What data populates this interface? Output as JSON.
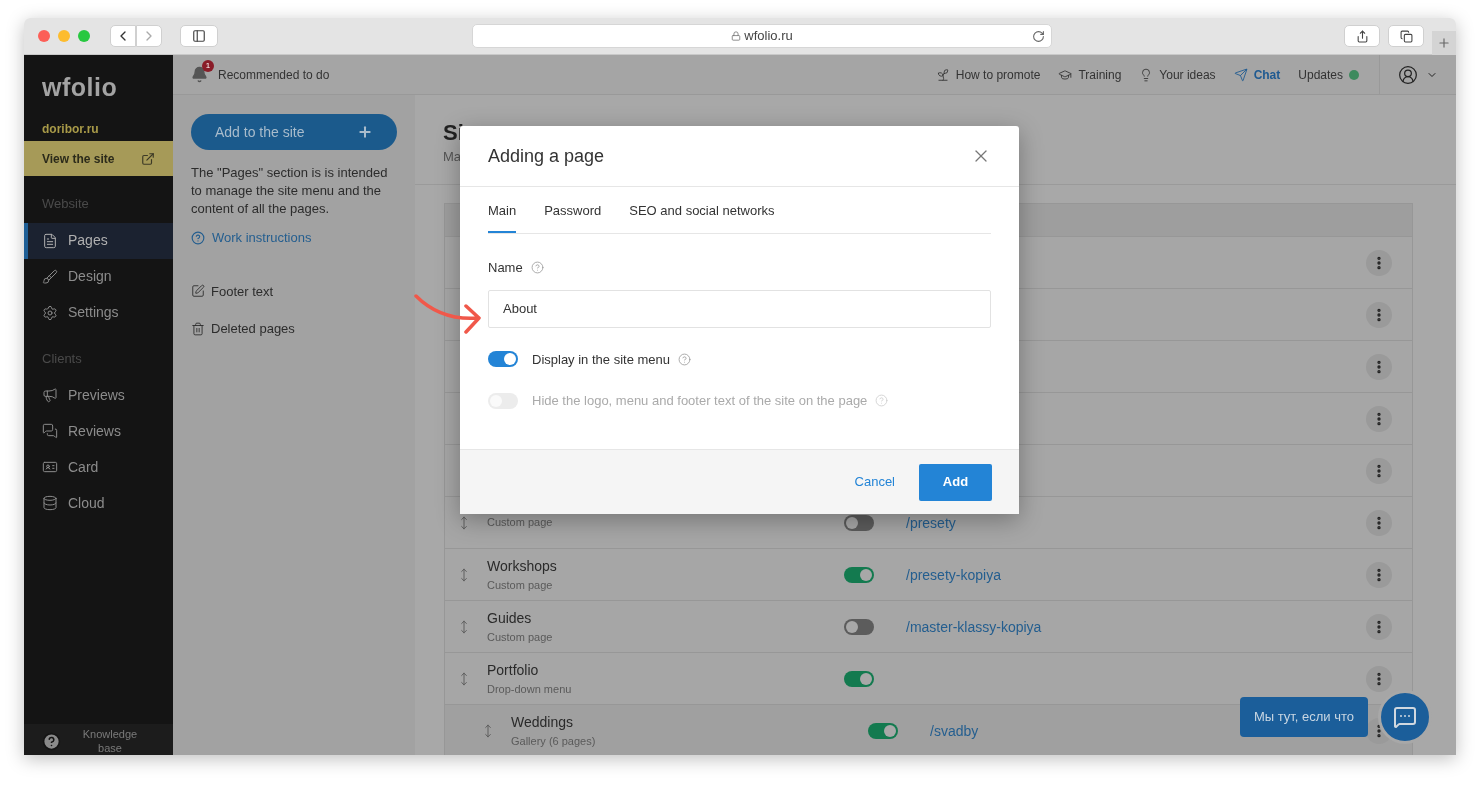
{
  "browser": {
    "address": "wfolio.ru"
  },
  "sidebar": {
    "logo": "wfolio",
    "site": "doribor.ru",
    "view_site": "View the site",
    "sections": [
      {
        "title": "Website",
        "items": [
          {
            "label": "Pages",
            "selected": true
          },
          {
            "label": "Design",
            "selected": false
          },
          {
            "label": "Settings",
            "selected": false
          }
        ]
      },
      {
        "title": "Clients",
        "items": [
          {
            "label": "Previews",
            "selected": false
          },
          {
            "label": "Reviews",
            "selected": false
          },
          {
            "label": "Card",
            "selected": false
          },
          {
            "label": "Cloud",
            "selected": false
          }
        ]
      }
    ],
    "help": "Knowledge base"
  },
  "topbar": {
    "notification": {
      "count": "1",
      "label": "Recommended to do"
    },
    "links": [
      {
        "label": "How to promote",
        "active": false,
        "dot": false
      },
      {
        "label": "Training",
        "active": false,
        "dot": false
      },
      {
        "label": "Your ideas",
        "active": false,
        "dot": false
      },
      {
        "label": "Chat",
        "active": true,
        "dot": false
      },
      {
        "label": "Updates",
        "active": false,
        "dot": true
      }
    ]
  },
  "left_panel": {
    "add_button": "Add to the site",
    "description": "The \"Pages\" section is is intended to manage the site menu and the content of all the pages.",
    "help_link": "Work instructions",
    "links": [
      {
        "label": "Footer text"
      },
      {
        "label": "Deleted pages"
      }
    ]
  },
  "page": {
    "title": "Si",
    "subtitle": "Ma"
  },
  "table": {
    "rows": [
      {},
      {},
      {},
      {},
      {},
      {
        "subtitle": "Custom page",
        "on": false,
        "link": "/presety"
      },
      {
        "title": "Workshops",
        "subtitle": "Custom page",
        "on": true,
        "link": "/presety-kopiya"
      },
      {
        "title": "Guides",
        "subtitle": "Custom page",
        "on": false,
        "link": "/master-klassy-kopiya"
      },
      {
        "title": "Portfolio",
        "subtitle": "Drop-down menu",
        "on": true,
        "children": [
          {
            "title": "Weddings",
            "subtitle": "Gallery (6 pages)",
            "on": true,
            "link": "/svadby"
          }
        ]
      }
    ]
  },
  "modal": {
    "title": "Adding a page",
    "tabs": [
      {
        "label": "Main",
        "selected": true
      },
      {
        "label": "Password",
        "selected": false
      },
      {
        "label": "SEO and social networks",
        "selected": false
      }
    ],
    "name_label": "Name",
    "name_value": "About",
    "toggles": [
      {
        "label": "Display in the site menu",
        "on": true,
        "disabled": false
      },
      {
        "label": "Hide the logo, menu and footer text of the site on the page",
        "on": false,
        "disabled": true
      }
    ],
    "cancel": "Cancel",
    "submit": "Add"
  },
  "chat_widget": {
    "bubble": "Мы тут, если что"
  }
}
